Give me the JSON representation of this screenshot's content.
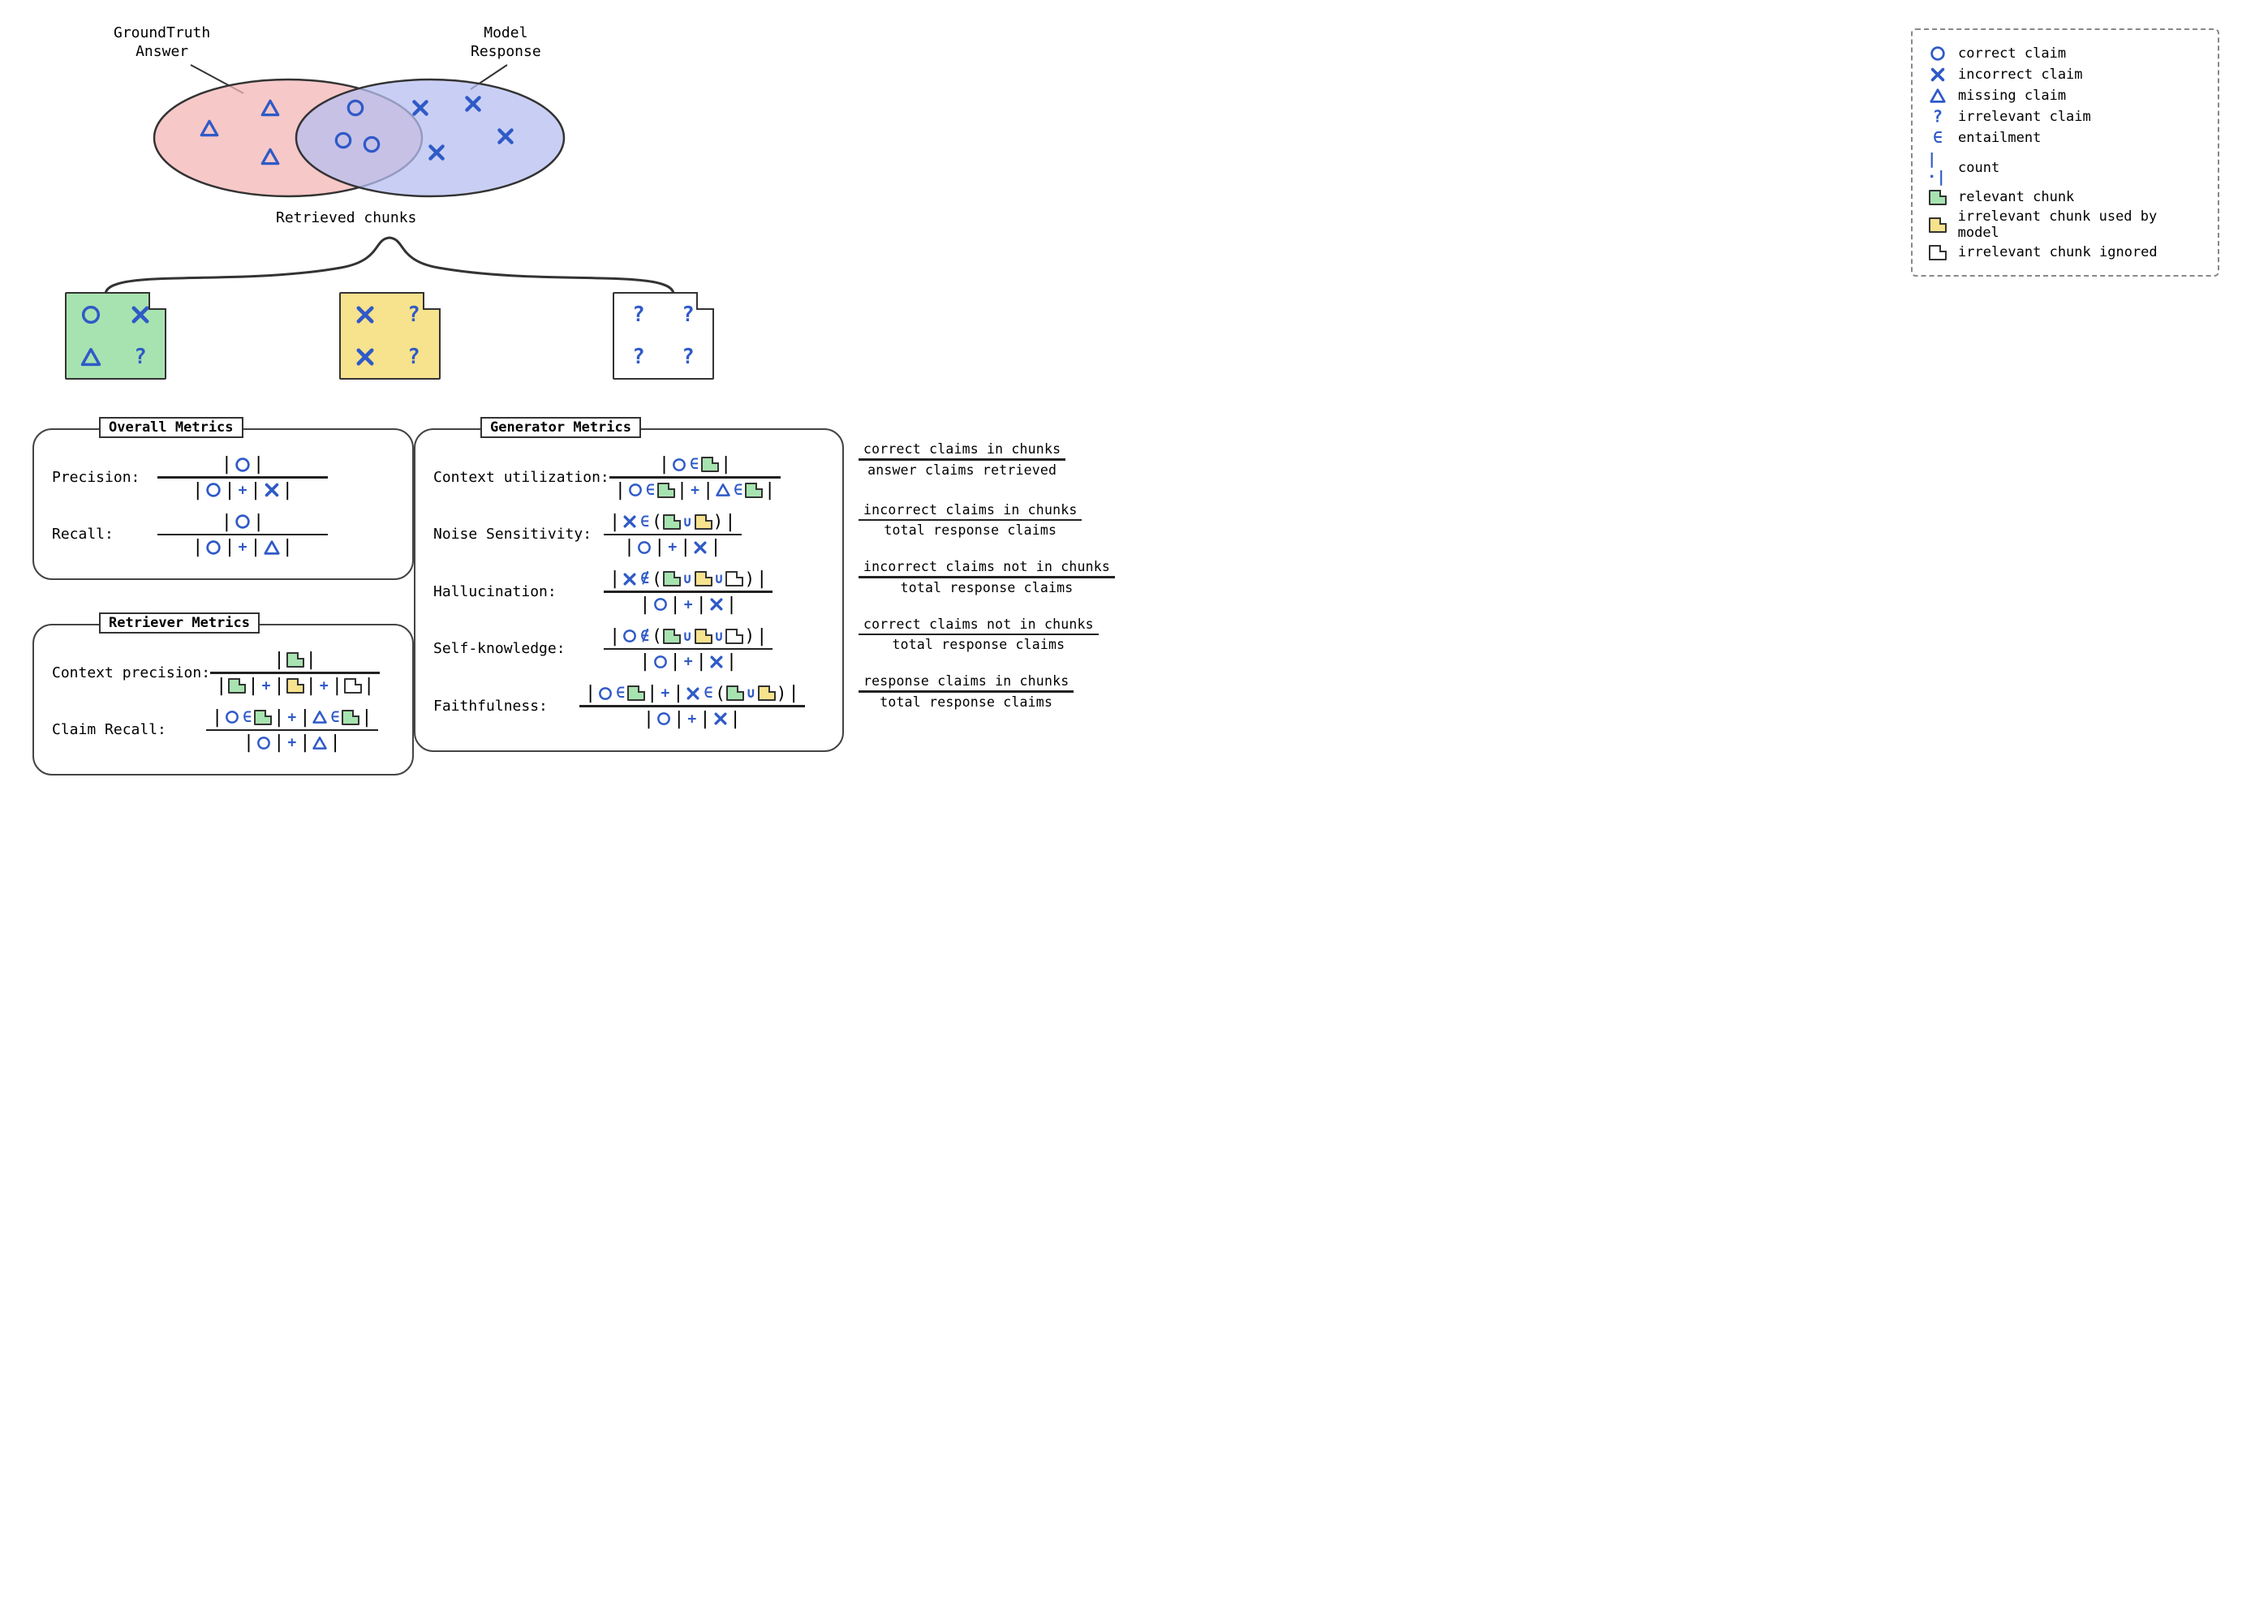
{
  "venn": {
    "gt_label_l1": "GroundTruth",
    "gt_label_l2": "Answer",
    "model_label_l1": "Model",
    "model_label_l2": "Response"
  },
  "chunks_label": "Retrieved chunks",
  "legend": {
    "correct": "correct claim",
    "incorrect": "incorrect claim",
    "missing": "missing claim",
    "irrelevant": "irrelevant claim",
    "entail": "entailment",
    "count": "count",
    "relevant_chunk": "relevant chunk",
    "irr_used": "irrelevant chunk used by model",
    "irr_ignored": "irrelevant chunk ignored"
  },
  "overall": {
    "title": "Overall Metrics",
    "precision": "Precision:",
    "recall": "Recall:"
  },
  "retriever": {
    "title": "Retriever Metrics",
    "ctx_prec": "Context precision:",
    "claim_recall": "Claim Recall:"
  },
  "generator": {
    "title": "Generator Metrics",
    "ctx_util": "Context utilization:",
    "noise": "Noise Sensitivity:",
    "halluc": "Hallucination:",
    "selfk": "Self-knowledge:",
    "faith": "Faithfulness:"
  },
  "explain": {
    "ctx_util_num": "correct claims in chunks",
    "ctx_util_den": "answer claims retrieved",
    "noise_num": "incorrect claims in chunks",
    "noise_den": "total response claims",
    "halluc_num": "incorrect claims not in chunks",
    "halluc_den": "total response claims",
    "selfk_num": "correct claims not in chunks",
    "selfk_den": "total response claims",
    "faith_num": "response claims in chunks",
    "faith_den": "total response claims"
  }
}
